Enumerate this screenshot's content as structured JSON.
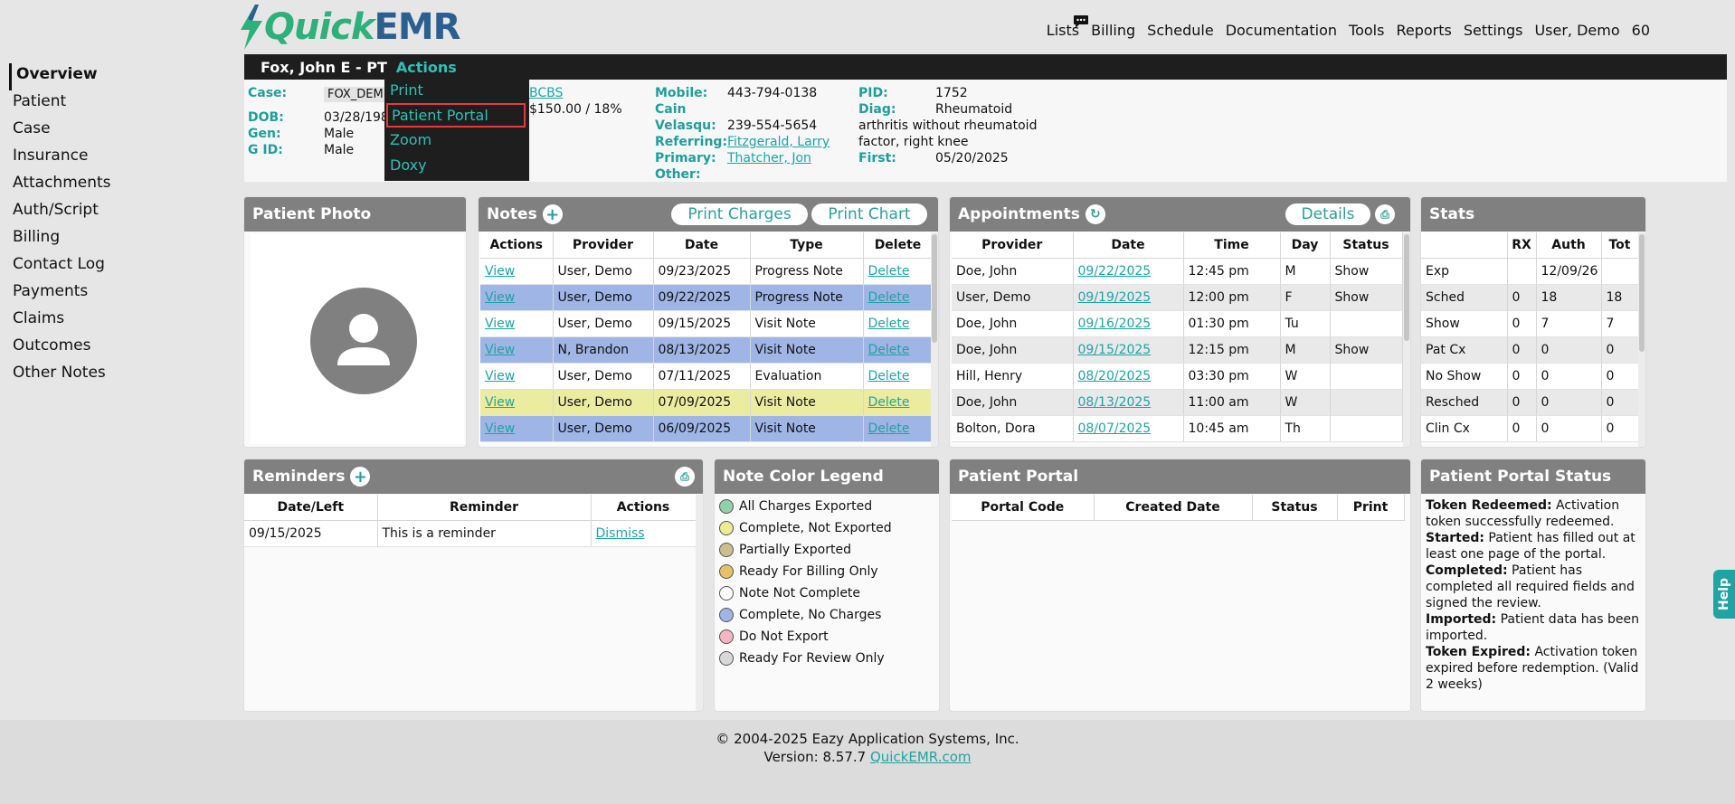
{
  "app": {
    "logo_quick": "Quick",
    "logo_emr": "EMR",
    "nav": [
      "Lists",
      "Billing",
      "Schedule",
      "Documentation",
      "Tools",
      "Reports",
      "Settings",
      "User, Demo",
      "60"
    ]
  },
  "sidebar": {
    "items": [
      "Overview",
      "Patient",
      "Case",
      "Insurance",
      "Attachments",
      "Auth/Script",
      "Billing",
      "Contact Log",
      "Payments",
      "Claims",
      "Outcomes",
      "Other Notes"
    ]
  },
  "patient": {
    "name": "Fox, John E - PT",
    "actions_label": "Actions",
    "case_label": "Case:",
    "case_value": "FOX_DEM",
    "dob_label": "DOB:",
    "dob_value": "03/28/198",
    "gen_label": "Gen:",
    "gen_value": "Male",
    "gid_label": "G ID:",
    "gid_value": "Male",
    "ins_value": "BCBS",
    "copay_value": "$150.00 / 18%",
    "mobile_label": "Mobile:",
    "mobile_value": "443-794-0138",
    "cain_label": "Cain",
    "velasqu_label": "Velasqu:",
    "velasqu_value": "239-554-5654",
    "referring_label": "Referring:",
    "referring_value": "Fitzgerald, Larry",
    "primary_label": "Primary:",
    "primary_value": "Thatcher, Jon",
    "other_label": "Other:",
    "pid_label": "PID:",
    "pid_value": "1752",
    "diag_label": "Diag:",
    "diag_value": "Rheumatoid",
    "diag_line2": "arthritis without rheumatoid",
    "diag_line3": "factor, right knee",
    "first_label": "First:",
    "first_value": "05/20/2025"
  },
  "actions_menu": {
    "print": "Print",
    "patient_portal": "Patient Portal",
    "zoom": "Zoom",
    "doxy": "Doxy"
  },
  "photo_panel": {
    "title": "Patient Photo"
  },
  "notes": {
    "title": "Notes",
    "print_charges": "Print Charges",
    "print_chart": "Print Chart",
    "headers": [
      "Actions",
      "Provider",
      "Date",
      "Type",
      "Delete"
    ],
    "rows": [
      {
        "action": "View",
        "provider": "User, Demo",
        "date": "09/23/2025",
        "type": "Progress Note",
        "delete": "Delete",
        "color": "white"
      },
      {
        "action": "View",
        "provider": "User, Demo",
        "date": "09/22/2025",
        "type": "Progress Note",
        "delete": "Delete",
        "color": "blue"
      },
      {
        "action": "View",
        "provider": "User, Demo",
        "date": "09/15/2025",
        "type": "Visit Note",
        "delete": "Delete",
        "color": "white"
      },
      {
        "action": "View",
        "provider": "N, Brandon",
        "date": "08/13/2025",
        "type": "Visit Note",
        "delete": "Delete",
        "color": "blue"
      },
      {
        "action": "View",
        "provider": "User, Demo",
        "date": "07/11/2025",
        "type": "Evaluation",
        "delete": "Delete",
        "color": "white"
      },
      {
        "action": "View",
        "provider": "User, Demo",
        "date": "07/09/2025",
        "type": "Visit Note",
        "delete": "Delete",
        "color": "yellow"
      },
      {
        "action": "View",
        "provider": "User, Demo",
        "date": "06/09/2025",
        "type": "Visit Note",
        "delete": "Delete",
        "color": "blue"
      }
    ]
  },
  "appointments": {
    "title": "Appointments",
    "details": "Details",
    "headers": [
      "Provider",
      "Date",
      "Time",
      "Day",
      "Status"
    ],
    "rows": [
      {
        "provider": "Doe, John",
        "date": "09/22/2025",
        "time": "12:45 pm",
        "day": "M",
        "status": "Show"
      },
      {
        "provider": "User, Demo",
        "date": "09/19/2025",
        "time": "12:00 pm",
        "day": "F",
        "status": "Show"
      },
      {
        "provider": "Doe, John",
        "date": "09/16/2025",
        "time": "01:30 pm",
        "day": "Tu",
        "status": ""
      },
      {
        "provider": "Doe, John",
        "date": "09/15/2025",
        "time": "12:15 pm",
        "day": "M",
        "status": "Show"
      },
      {
        "provider": "Hill, Henry",
        "date": "08/20/2025",
        "time": "03:30 pm",
        "day": "W",
        "status": ""
      },
      {
        "provider": "Doe, John",
        "date": "08/13/2025",
        "time": "11:00 am",
        "day": "W",
        "status": ""
      },
      {
        "provider": "Bolton, Dora",
        "date": "08/07/2025",
        "time": "10:45 am",
        "day": "Th",
        "status": ""
      }
    ]
  },
  "stats": {
    "title": "Stats",
    "headers": [
      "",
      "RX",
      "Auth",
      "Tot"
    ],
    "rows": [
      {
        "label": "Exp",
        "rx": "",
        "auth": "12/09/26",
        "tot": ""
      },
      {
        "label": "Sched",
        "rx": "0",
        "auth": "18",
        "tot": "18"
      },
      {
        "label": "Show",
        "rx": "0",
        "auth": "7",
        "tot": "7"
      },
      {
        "label": "Pat Cx",
        "rx": "0",
        "auth": "0",
        "tot": "0"
      },
      {
        "label": "No Show",
        "rx": "0",
        "auth": "0",
        "tot": "0"
      },
      {
        "label": "Resched",
        "rx": "0",
        "auth": "0",
        "tot": "0"
      },
      {
        "label": "Clin Cx",
        "rx": "0",
        "auth": "0",
        "tot": "0"
      }
    ]
  },
  "reminders": {
    "title": "Reminders",
    "headers": [
      "Date/Left",
      "Reminder",
      "Actions"
    ],
    "rows": [
      {
        "date": "09/15/2025",
        "reminder": "This is a reminder",
        "action": "Dismiss"
      }
    ]
  },
  "legend": {
    "title": "Note Color Legend",
    "items": [
      {
        "label": "All Charges Exported",
        "color": "#8fd1a8"
      },
      {
        "label": "Complete, Not Exported",
        "color": "#ecec90"
      },
      {
        "label": "Partially Exported",
        "color": "#cbbf8e"
      },
      {
        "label": "Ready For Billing Only",
        "color": "#e7c16a"
      },
      {
        "label": "Note Not Complete",
        "color": "#ffffff"
      },
      {
        "label": "Complete, No Charges",
        "color": "#9eb5e5"
      },
      {
        "label": "Do Not Export",
        "color": "#f4b6c2"
      },
      {
        "label": "Ready For Review Only",
        "color": "#d8d8d8"
      }
    ]
  },
  "portal": {
    "title": "Patient Portal",
    "headers": [
      "Portal Code",
      "Created Date",
      "Status",
      "Print"
    ]
  },
  "portal_status": {
    "title": "Patient Portal Status",
    "entries": [
      {
        "term": "Token Redeemed:",
        "desc": " Activation token successfully redeemed."
      },
      {
        "term": "Started:",
        "desc": " Patient has filled out at least one page of the portal."
      },
      {
        "term": "Completed:",
        "desc": " Patient has completed all required fields and signed the review."
      },
      {
        "term": "Imported:",
        "desc": " Patient data has been imported."
      },
      {
        "term": "Token Expired:",
        "desc": " Activation token expired before redemption. (Valid 2 weeks)"
      }
    ]
  },
  "footer": {
    "copyright": "© 2004-2025 Eazy Application Systems, Inc.",
    "version": "Version: 8.57.7",
    "link": "QuickEMR.com"
  },
  "help": {
    "label": "Help"
  },
  "colors": {
    "accent": "#1fa3a3",
    "header": "#808080",
    "dark": "#1e1e1e",
    "highlight": "#e53a3a"
  }
}
